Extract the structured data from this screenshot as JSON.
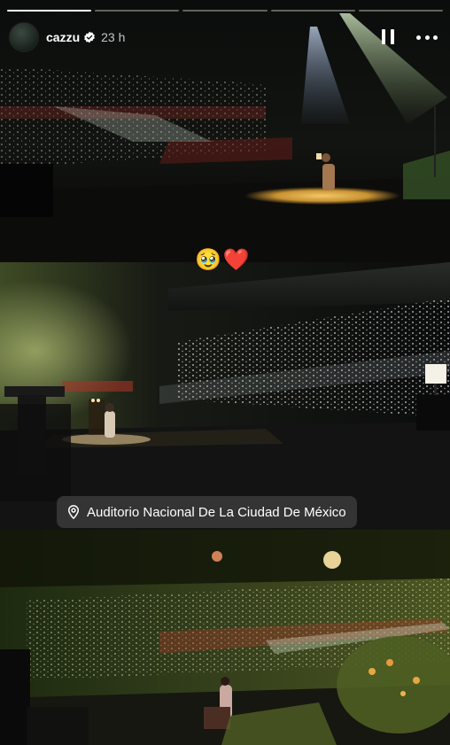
{
  "story": {
    "progress": [
      1,
      0,
      0,
      0,
      0
    ]
  },
  "header": {
    "username": "cazzu",
    "time": "23 h",
    "avatar_icon": "avatar-icon",
    "verified_icon": "verified-badge-icon",
    "pause_icon": "pause-icon",
    "more_icon": "more-options-icon"
  },
  "stickers": {
    "emojis": "🥹❤️",
    "location": "Auditorio Nacional De La Ciudad De México",
    "location_icon": "location-pin-icon"
  },
  "colors": {
    "background": "#000000",
    "sticker_bg": "#3c3c3c"
  }
}
